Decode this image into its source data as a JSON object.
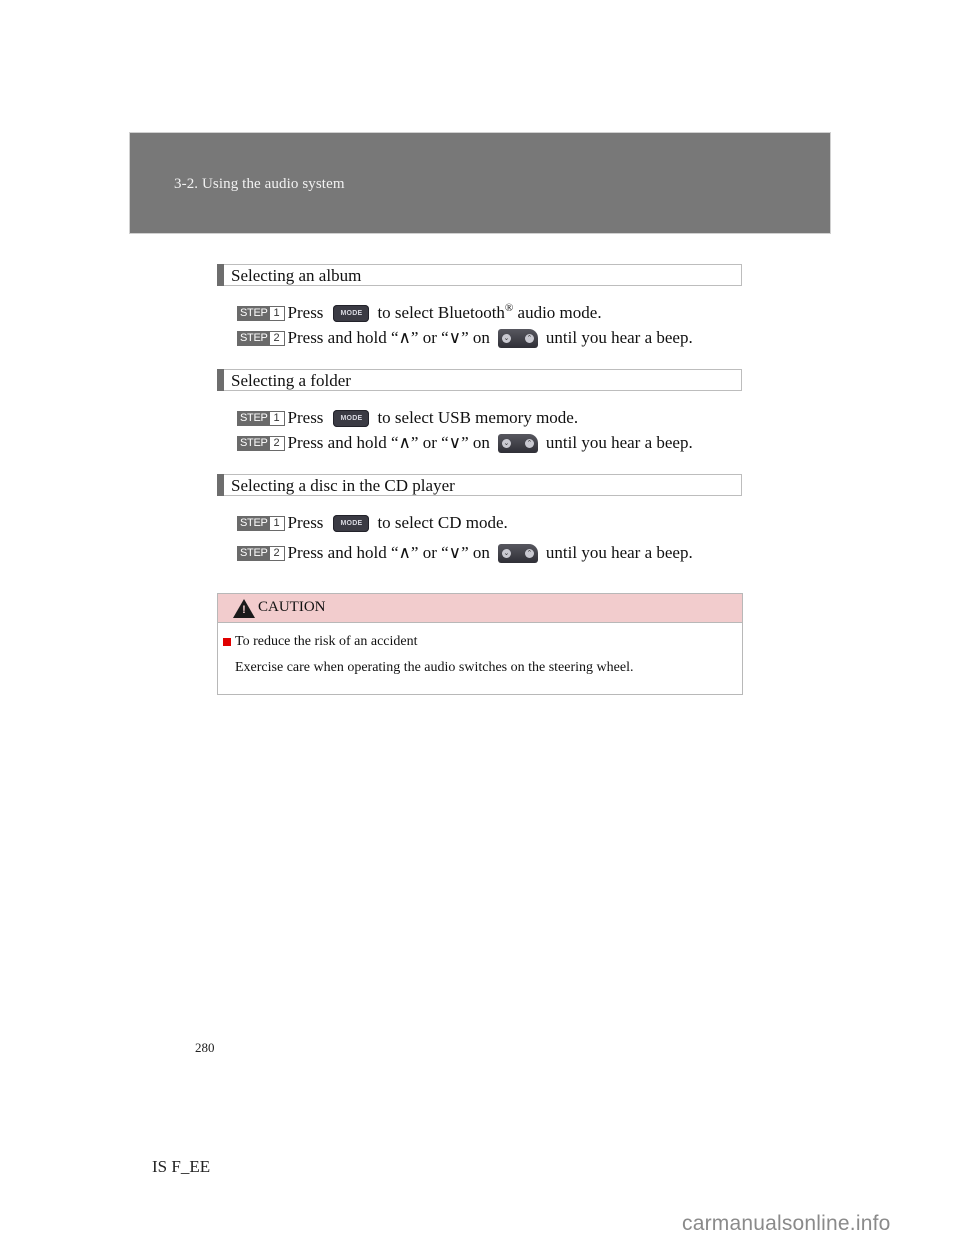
{
  "header": {
    "section_title": "3-2. Using the audio system"
  },
  "sections": [
    {
      "heading": "Selecting an album",
      "steps": [
        {
          "badge_label": "STEP",
          "badge_number": "1",
          "prefix": "Press",
          "control_icon": "mode-button-icon",
          "control_text": "MODE",
          "suffix_before_sup": "to select Bluetooth",
          "sup": "®",
          "suffix_after_sup": " audio mode."
        },
        {
          "badge_label": "STEP",
          "badge_number": "2",
          "prefix": "Press and hold “∧” or “∨” on",
          "control_icon": "seek-switch-icon",
          "suffix": "until you hear a beep."
        }
      ]
    },
    {
      "heading": "Selecting a folder",
      "steps": [
        {
          "badge_label": "STEP",
          "badge_number": "1",
          "prefix": "Press",
          "control_icon": "mode-button-icon",
          "control_text": "MODE",
          "suffix": "to select USB memory mode."
        },
        {
          "badge_label": "STEP",
          "badge_number": "2",
          "prefix": "Press and hold “∧” or “∨” on",
          "control_icon": "seek-switch-icon",
          "suffix": "until you hear a beep."
        }
      ]
    },
    {
      "heading": "Selecting a disc in the CD player",
      "steps": [
        {
          "badge_label": "STEP",
          "badge_number": "1",
          "prefix": "Press",
          "control_icon": "mode-button-icon",
          "control_text": "MODE",
          "suffix": "to select CD mode."
        },
        {
          "badge_label": "STEP",
          "badge_number": "2",
          "prefix": "Press and hold “∧” or “∨” on",
          "control_icon": "seek-switch-icon",
          "suffix": "until you hear a beep."
        }
      ]
    }
  ],
  "caution": {
    "icon": "warning-triangle-icon",
    "icon_glyph": "!",
    "title": "CAUTION",
    "item_title": "To reduce the risk of an accident",
    "item_body": "Exercise care when operating the audio switches on the steering wheel.",
    "header_color": "#f2cccd",
    "bullet_color": "#e00000"
  },
  "seek_switch": {
    "down_glyph": "⌄",
    "up_glyph": "⌃"
  },
  "footer": {
    "page_number": "280",
    "doc_code": "IS F_EE",
    "watermark": "carmanualsonline.info"
  }
}
